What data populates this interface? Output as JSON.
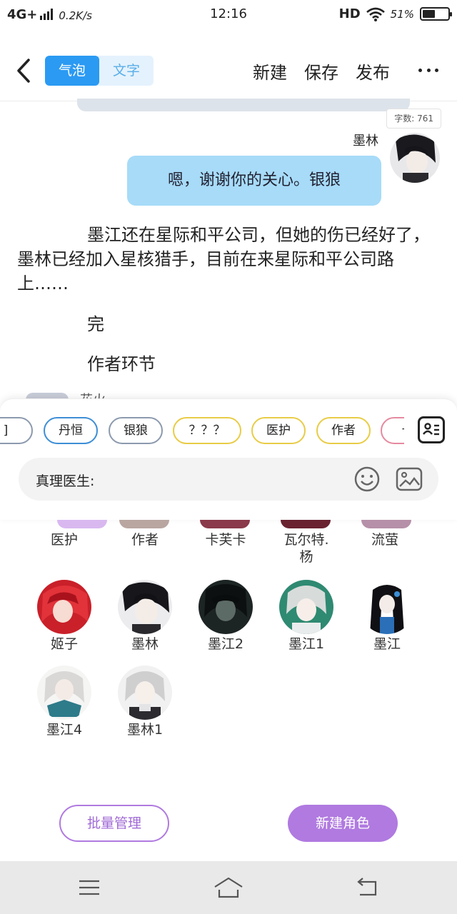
{
  "status_bar": {
    "network": "4G+",
    "speed": "0.2K/s",
    "time": "12:16",
    "hd": "HD",
    "battery_pct": "51%",
    "battery_level": 0.51
  },
  "header": {
    "tabs": [
      {
        "label": "气泡",
        "active": true
      },
      {
        "label": "文字",
        "active": false
      }
    ],
    "actions": [
      "新建",
      "保存",
      "发布"
    ]
  },
  "word_count": "字数: 761",
  "message": {
    "sender": "墨林",
    "text": "嗯，谢谢你的关心。银狼"
  },
  "narration": "墨江还在星际和平公司，但她的伤已经好了，墨林已经加入星核猎手，目前在来星际和平公司路上……",
  "line_end": "完",
  "line_author": "作者环节",
  "peek_name": "花火",
  "chips": [
    {
      "label": "]",
      "color": "grey"
    },
    {
      "label": "丹恒",
      "color": "blue"
    },
    {
      "label": "银狼",
      "color": "grey"
    },
    {
      "label": "？？？",
      "color": "yellow"
    },
    {
      "label": "医护",
      "color": "yellow"
    },
    {
      "label": "作者",
      "color": "yellow"
    },
    {
      "label": "卡",
      "color": "pink"
    }
  ],
  "input": {
    "label": "真理医生:"
  },
  "characters_row1": [
    "医护",
    "作者",
    "卡芙卡",
    "瓦尔特.杨",
    "流萤"
  ],
  "characters": [
    {
      "name": "姬子"
    },
    {
      "name": "墨林"
    },
    {
      "name": "墨江2"
    },
    {
      "name": "墨江1"
    },
    {
      "name": "墨江"
    },
    {
      "name": "墨江4"
    },
    {
      "name": "墨林1"
    }
  ],
  "buttons": {
    "batch": "批量管理",
    "new_role": "新建角色"
  }
}
